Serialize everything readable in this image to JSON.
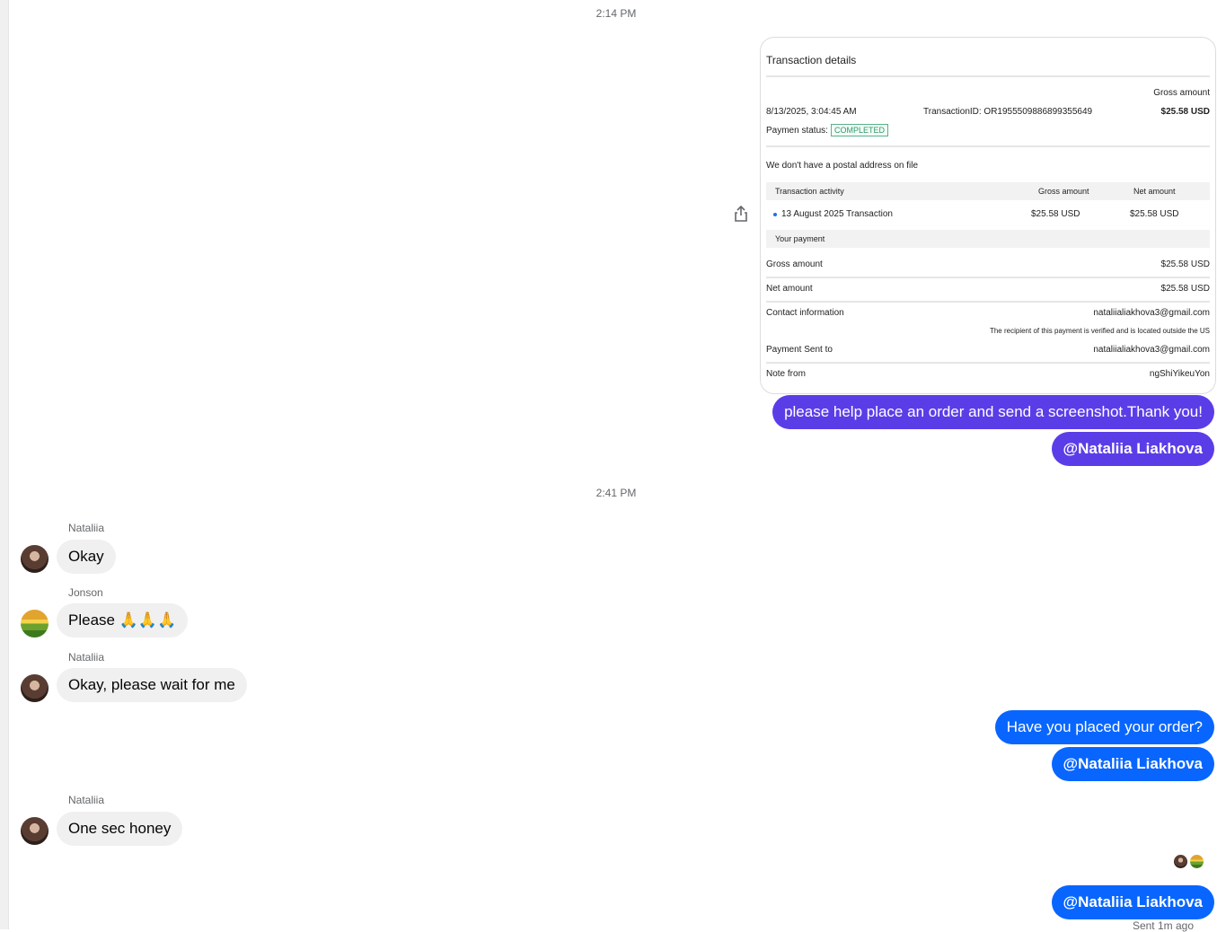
{
  "timestamps": [
    "2:14 PM",
    "2:41 PM"
  ],
  "attachment": {
    "title": "Transaction details",
    "gross_amount_label": "Gross amount",
    "datetime": "8/13/2025, 3:04:45 AM",
    "transaction_id": "TransactionID: OR1955509886899355649",
    "gross_amount_value": "$25.58 USD",
    "payment_status_label": "Paymen status:",
    "payment_status_value": "COMPLETED",
    "postal_notice": "We don't have a postal address on file",
    "activity_header": [
      "Transaction activity",
      "Gross amount",
      "Net amount"
    ],
    "activity_row": [
      "13 August 2025 Transaction",
      "$25.58 USD",
      "$25.58 USD"
    ],
    "your_payment": "Your payment",
    "rows": [
      {
        "label": "Gross amount",
        "value": "$25.58 USD"
      },
      {
        "label": "Net amount",
        "value": "$25.58 USD"
      },
      {
        "label": "Contact information",
        "value": "nataliialiakhova3@gmail.com"
      },
      {
        "label": "Payment Sent to",
        "value": "nataliialiakhova3@gmail.com"
      },
      {
        "label": "Note from",
        "value": "ngShiYikeuYon"
      }
    ],
    "recipient_note": "The recipient of this payment is verified and is located outside the US"
  },
  "messages": {
    "out1": "please help place an order and send a screenshot.Thank you!",
    "mention1": "@Nataliia Liakhova",
    "in1_name": "Nataliia",
    "in1": "Okay",
    "in2_name": "Jonson",
    "in2": "Please 🙏🙏🙏",
    "in3_name": "Nataliia",
    "in3": "Okay, please wait for me",
    "out2": "Have you placed your order?",
    "mention2": "@Nataliia Liakhova",
    "in4_name": "Nataliia",
    "in4": "One sec honey",
    "mention3": "@Nataliia Liakhova",
    "sent_status": "Sent 1m ago"
  },
  "colors": {
    "purple_bubble": "#5b3de8",
    "blue_bubble": "#0866ff",
    "incoming_bubble": "#f0f0f0"
  },
  "icons": [
    "share-icon"
  ]
}
